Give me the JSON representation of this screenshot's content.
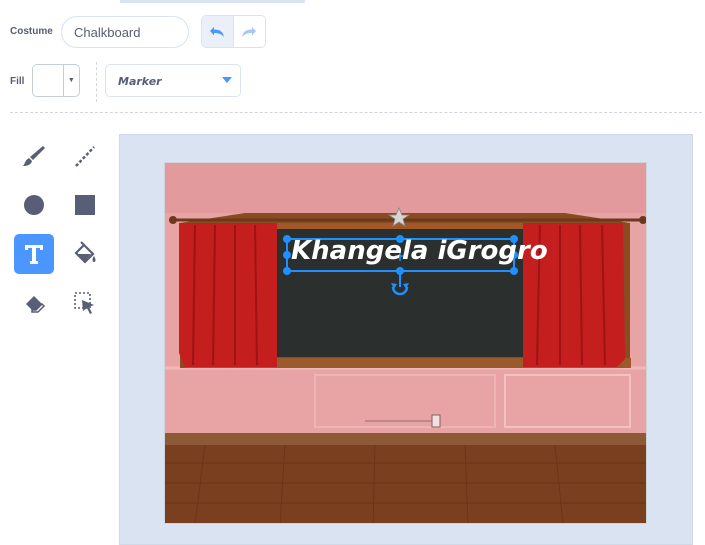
{
  "toolbar": {
    "costume_label": "Costume",
    "costume_name": "Chalkboard",
    "fill_label": "Fill",
    "fill_color": "#ffffff",
    "font_value": "Marker"
  },
  "canvas": {
    "text_content": "Khangela iGrogro"
  },
  "tools": [
    "brush-tool",
    "line-tool",
    "circle-tool",
    "rectangle-tool",
    "text-tool",
    "fill-tool",
    "eraser-tool",
    "select-tool"
  ],
  "selected_tool": "text-tool",
  "colors": {
    "accent": "#4c97ff",
    "selection": "#1e90ff",
    "canvas_bg": "#d9e3f2",
    "icon": "#575e75"
  }
}
